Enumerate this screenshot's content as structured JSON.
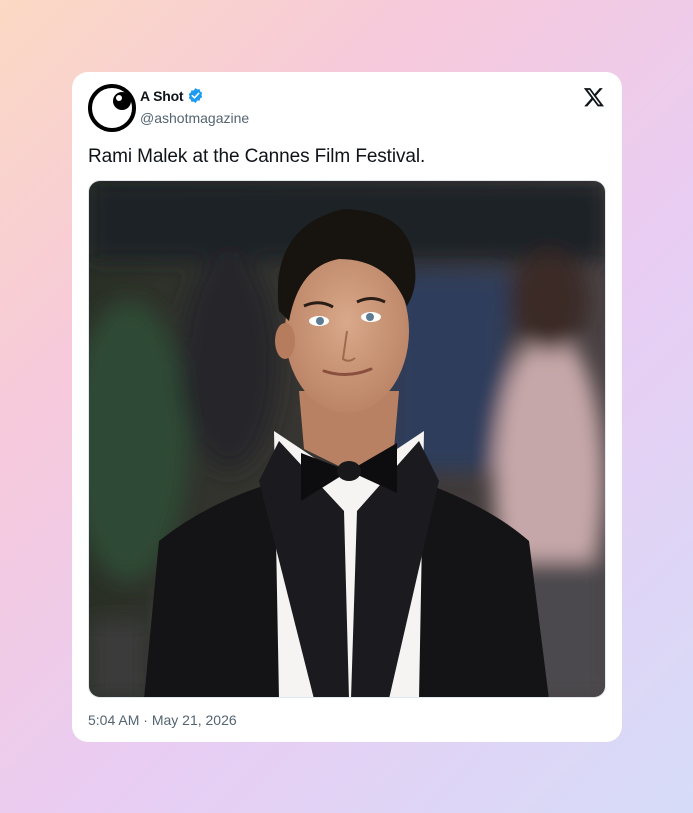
{
  "tweet": {
    "author_name": "A Shot",
    "author_handle": "@ashotmagazine",
    "verified": true,
    "text": "Rami Malek at the Cannes Film Festival.",
    "time": "5:04 AM",
    "separator": "·",
    "date": "May 21, 2026"
  },
  "icons": {
    "avatar": "eye-logo-icon",
    "verified": "verified-badge-icon",
    "platform": "x-logo-icon"
  },
  "colors": {
    "verified_blue": "#1d9bf0",
    "text_primary": "#0f1419",
    "text_secondary": "#536471"
  }
}
